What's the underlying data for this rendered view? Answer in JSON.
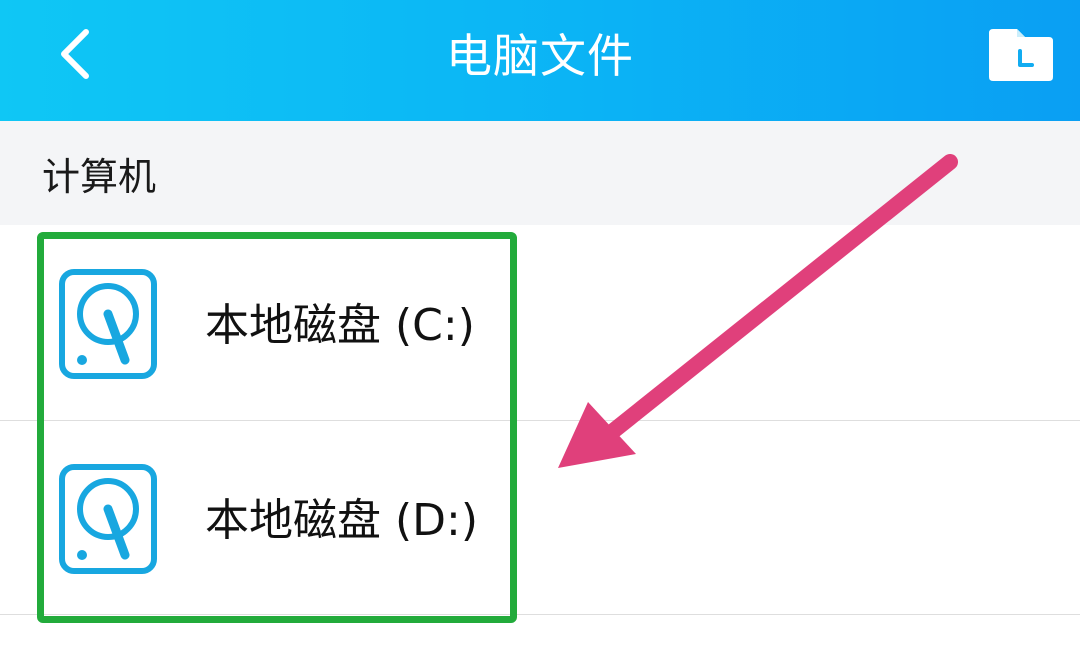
{
  "header": {
    "title": "电脑文件",
    "back_icon": "chevron-left-icon",
    "folder_icon": "folder-icon"
  },
  "section": {
    "label": "计算机"
  },
  "drives": [
    {
      "label": "本地磁盘 (C:)",
      "icon": "hard-drive-icon"
    },
    {
      "label": "本地磁盘 (D:)",
      "icon": "hard-drive-icon"
    }
  ],
  "colors": {
    "header_gradient_start": "#0fc7f5",
    "header_gradient_end": "#0a9ff3",
    "icon_blue": "#18a7e0",
    "highlight_green": "#22ab3b",
    "arrow_pink": "#e0407b",
    "section_bg": "#f4f5f7"
  }
}
